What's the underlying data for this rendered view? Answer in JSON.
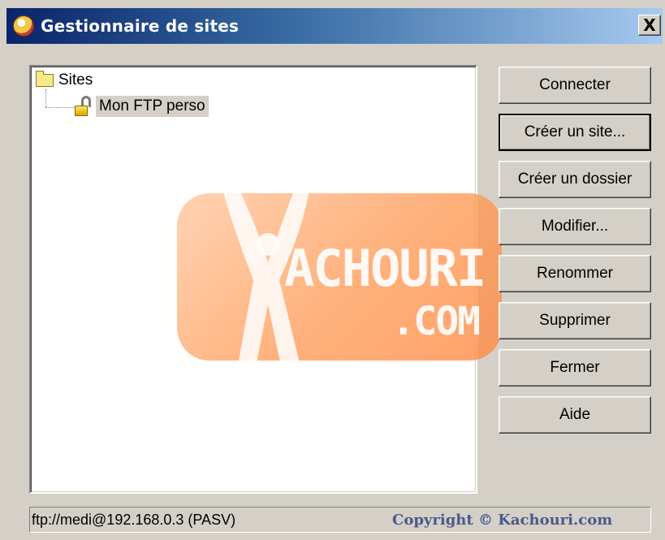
{
  "window": {
    "title": "Gestionnaire de sites",
    "close_label": "X"
  },
  "tree": {
    "root_label": "Sites",
    "child_label": "Mon FTP perso"
  },
  "watermark": {
    "brand": "ACHOURI",
    "sub": ".COM"
  },
  "buttons": {
    "connect": "Connecter",
    "create_site": "Créer un site...",
    "create_folder": "Créer un dossier",
    "edit": "Modifier...",
    "rename": "Renommer",
    "delete": "Supprimer",
    "close": "Fermer",
    "help": "Aide"
  },
  "status": {
    "connection": "ftp://medi@192.168.0.3 (PASV)",
    "copyright": "Copyright © Kachouri.com"
  }
}
